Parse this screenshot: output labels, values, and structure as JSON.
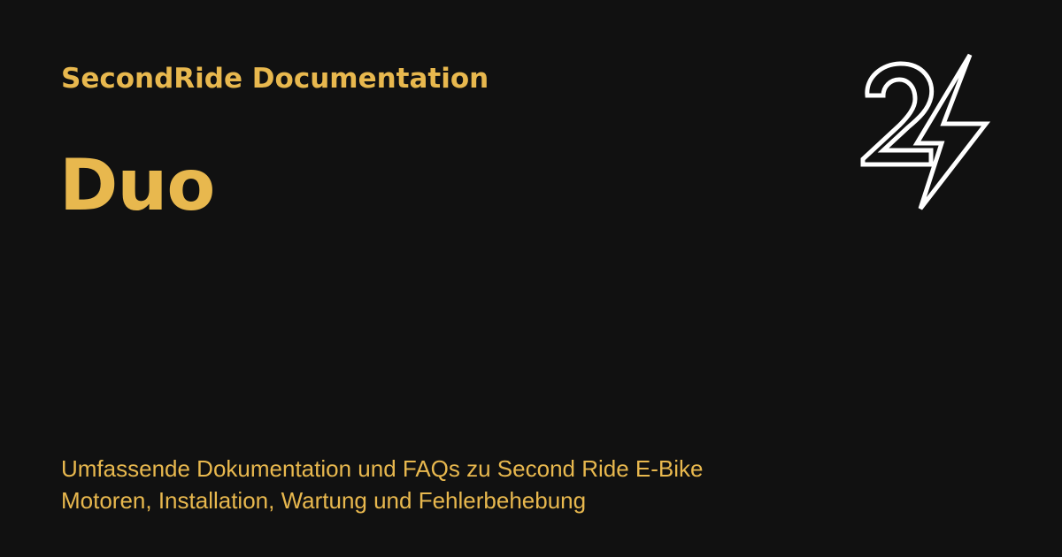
{
  "colors": {
    "background": "#111111",
    "accent": "#E8B84E",
    "logo": "#FFFFFF"
  },
  "header": {
    "eyebrow": "SecondRide Documentation"
  },
  "page": {
    "title": "Duo",
    "description_line1": "Umfassende Dokumentation und FAQs zu Second Ride E-Bike",
    "description_line2": "Motoren, Installation, Wartung und Fehlerbehebung"
  },
  "logo": {
    "icon": "secondride-2-lightning-logo-icon"
  }
}
